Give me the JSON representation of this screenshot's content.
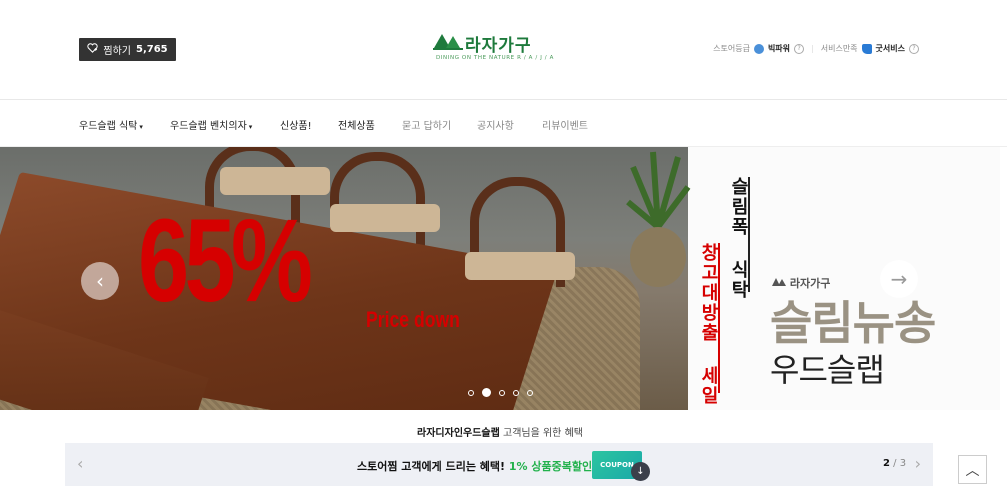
{
  "header": {
    "favorite_label": "찜하기",
    "favorite_count": "5,765",
    "logo_name": "라자가구",
    "logo_tagline": "DINING ON THE NATURE R / A / J / A",
    "store_grade_label": "스토어등급",
    "store_grade_value": "빅파워",
    "service_label": "서비스만족",
    "service_value": "굿서비스",
    "help_glyph": "?"
  },
  "nav": {
    "items": [
      {
        "label": "우드슬랩 식탁",
        "has_caret": true
      },
      {
        "label": "우드슬랩 벤치의자",
        "has_caret": true
      },
      {
        "label": "신상품!"
      },
      {
        "label": "전체상품"
      },
      {
        "label": "묻고 답하기"
      },
      {
        "label": "공지사항"
      },
      {
        "label": "리뷰이벤트"
      }
    ],
    "caret_glyph": "▾"
  },
  "banner": {
    "discount": "65%",
    "price_text": "Price down",
    "vertical_black": "슬림폭 식탁",
    "vertical_red": "창고대방출 세일",
    "side_logo": "라자가구",
    "title_line1": "슬림뉴송",
    "title_line2": "우드슬랩",
    "prev_glyph": "‹",
    "next_glyph": "→",
    "slide_count": 5,
    "active_slide": 2
  },
  "benefits": {
    "title_bold": "라자디자인우드슬랩",
    "title_rest": " 고객님을 위한 혜택",
    "message": "스토어찜 고객에게 드리는 혜택! ",
    "highlight": "1% 상품중복할인",
    "coupon_label": "COUPON",
    "download_glyph": "↓",
    "page_current": "2",
    "page_total": "/ 3",
    "prev_glyph": "‹",
    "next_glyph": "›"
  },
  "top_button_glyph": "︿",
  "colors": {
    "accent_red": "#d60000",
    "brand_green": "#1e7a3c",
    "highlight_green": "#22b14c"
  }
}
